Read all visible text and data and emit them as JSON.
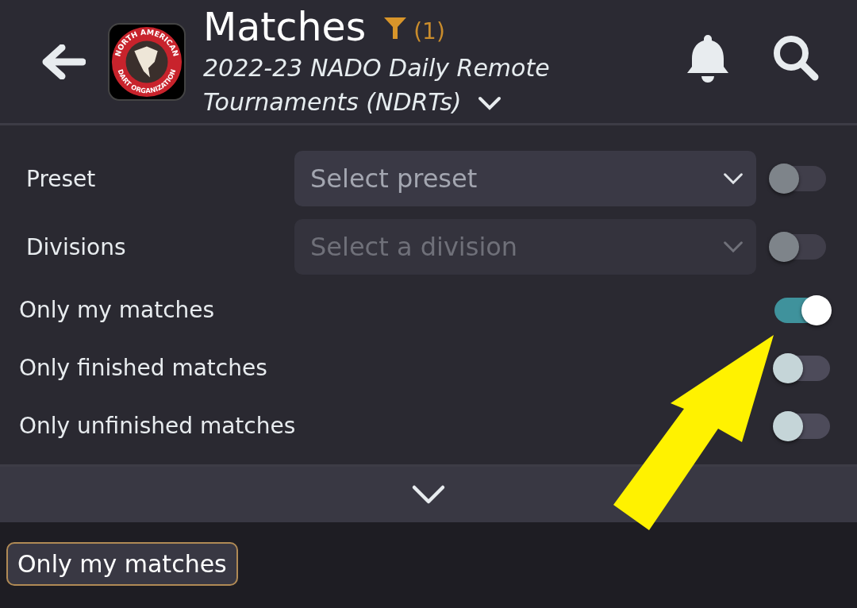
{
  "header": {
    "title": "Matches",
    "filter_count": "(1)",
    "subtitle": "2022-23 NADO Daily Remote Tournaments (NDRTs)",
    "logo": {
      "top_text": "NORTH AMERICAN",
      "bottom_text": "DART ORGANIZATION"
    }
  },
  "filters": [
    {
      "kind": "select",
      "label": "Preset",
      "placeholder": "Select preset",
      "disabled": false,
      "toggle": {
        "on": false,
        "disabled": true
      }
    },
    {
      "kind": "select",
      "label": "Divisions",
      "placeholder": "Select a division",
      "disabled": true,
      "toggle": {
        "on": false,
        "disabled": true
      }
    },
    {
      "kind": "toggle",
      "label": "Only my matches",
      "toggle": {
        "on": true,
        "disabled": false
      }
    },
    {
      "kind": "toggle",
      "label": "Only finished matches",
      "toggle": {
        "on": false,
        "disabled": false
      }
    },
    {
      "kind": "toggle",
      "label": "Only unfinished matches",
      "toggle": {
        "on": false,
        "disabled": false
      }
    }
  ],
  "active_chips": [
    "Only my matches"
  ]
}
